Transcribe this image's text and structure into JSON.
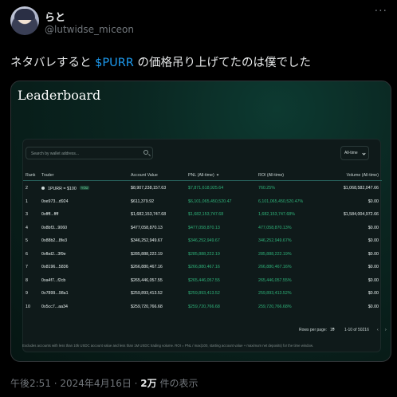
{
  "tweet": {
    "display_name": "らと",
    "handle": "@lutwidse_miceon",
    "more_icon": "more-dots-icon",
    "text_before": "ネタバレすると ",
    "cashtag": "$PURR",
    "text_after": " の価格吊り上げてたのは僕でした",
    "timestamp": "午後2:51 · 2024年4月16日 · ",
    "views_count": "2万",
    "views_suffix": " 件の表示"
  },
  "leaderboard": {
    "title": "Leaderboard",
    "search_placeholder": "Search by wallet address...",
    "time_filter": "All-time",
    "columns": {
      "rank": "Rank",
      "trader": "Trader",
      "account_value": "Account Value",
      "pnl": "PNL (All-time)",
      "roi": "ROI (All-time)",
      "volume": "Volume (All-time)"
    },
    "rows": [
      {
        "rank": "2",
        "trader": "1PURR = $100",
        "badge": "YOU",
        "account_value": "$8,907,238,157.63",
        "pnl": "$7,871,618,925.64",
        "roi": "760.25%",
        "volume": "$1,068,582,047.66"
      },
      {
        "rank": "1",
        "trader": "0xe973...d924",
        "account_value": "$611,379.92",
        "pnl": "$6,101,065,450,520.47",
        "roi": "6,101,065,450,520.47%",
        "volume": "$0.00"
      },
      {
        "rank": "3",
        "trader": "0xffff...ffff",
        "account_value": "$1,682,153,747.68",
        "pnl": "$1,682,153,747.68",
        "roi": "1,682,153,747.68%",
        "volume": "$1,584,004,972.66"
      },
      {
        "rank": "4",
        "trader": "0x8bf3...9060",
        "account_value": "$477,058,870.13",
        "pnl": "$477,058,870.13",
        "roi": "477,058,870.13%",
        "volume": "$0.00"
      },
      {
        "rank": "5",
        "trader": "0x88b2...8fe3",
        "account_value": "$346,252,949.67",
        "pnl": "$346,252,949.67",
        "roi": "346,252,949.67%",
        "volume": "$0.00"
      },
      {
        "rank": "6",
        "trader": "0xfbd2...3f9e",
        "account_value": "$285,888,222.19",
        "pnl": "$285,888,222.19",
        "roi": "285,888,222.19%",
        "volume": "$0.00"
      },
      {
        "rank": "7",
        "trader": "0x8196...5836",
        "account_value": "$266,880,467.16",
        "pnl": "$266,880,467.16",
        "roi": "266,880,467.16%",
        "volume": "$0.00"
      },
      {
        "rank": "8",
        "trader": "0xa4f7...f2cb",
        "account_value": "$265,446,057.55",
        "pnl": "$265,446,057.55",
        "roi": "265,446,057.55%",
        "volume": "$0.00"
      },
      {
        "rank": "9",
        "trader": "0x7899...98a1",
        "account_value": "$259,893,413.52",
        "pnl": "$259,893,413.52",
        "roi": "259,893,413.52%",
        "volume": "$0.00"
      },
      {
        "rank": "10",
        "trader": "0x5cc7...aa34",
        "account_value": "$259,720,766.68",
        "pnl": "$259,720,766.68",
        "roi": "259,720,766.68%",
        "volume": "$0.00"
      }
    ],
    "pagination": {
      "rows_per_page_label": "Rows per page:",
      "rows_per_page_value": "10",
      "range": "1-10 of 50216",
      "prev_icon": "chevron-left-icon",
      "next_icon": "chevron-right-icon"
    },
    "footnote": "Excludes accounts with less than 10k USDC account value and less than 1M USDC trading volume. ROI = PNL / max(100, starting account value + maximum net deposits) for the time window."
  },
  "colors": {
    "accent_blue": "#1d9bf0",
    "pnl_green": "#2fb37a",
    "panel_bg": "#0f1a1a"
  }
}
